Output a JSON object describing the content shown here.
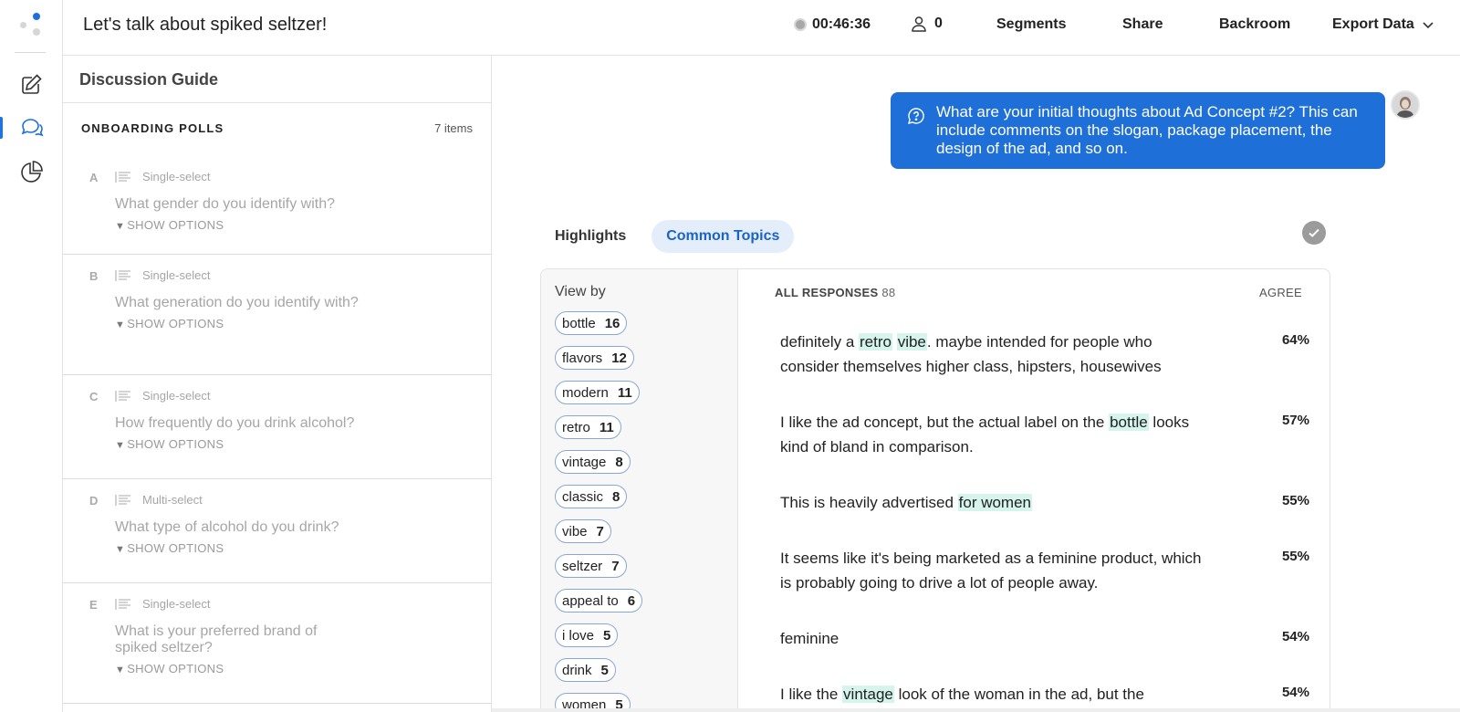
{
  "header": {
    "title": "Let's talk about spiked seltzer!",
    "timer": "00:46:36",
    "participants": "0",
    "segments": "Segments",
    "share": "Share",
    "backroom": "Backroom",
    "export": "Export Data"
  },
  "guide": {
    "title": "Discussion Guide",
    "section_name": "ONBOARDING POLLS",
    "section_count": "7 items",
    "show_options": "SHOW OPTIONS",
    "questions": [
      {
        "letter": "A",
        "type": "Single-select",
        "text": "What gender do you identify with?"
      },
      {
        "letter": "B",
        "type": "Single-select",
        "text": "What generation do you identify with?"
      },
      {
        "letter": "C",
        "type": "Single-select",
        "text": "How frequently do you drink alcohol?"
      },
      {
        "letter": "D",
        "type": "Multi-select",
        "text": "What type of alcohol do you drink?"
      },
      {
        "letter": "E",
        "type": "Single-select",
        "text": "What is your preferred brand of spiked seltzer?"
      }
    ]
  },
  "main": {
    "prompt": "What are your initial thoughts about Ad Concept #2? This can include comments on the slogan, package placement, the design of the ad, and so on.",
    "tabs": [
      {
        "label": "Highlights",
        "active": false
      },
      {
        "label": "Common Topics",
        "active": true
      }
    ],
    "view_by": "View by",
    "topics": [
      {
        "label": "bottle",
        "count": "16"
      },
      {
        "label": "flavors",
        "count": "12"
      },
      {
        "label": "modern",
        "count": "11"
      },
      {
        "label": "retro",
        "count": "11"
      },
      {
        "label": "vintage",
        "count": "8"
      },
      {
        "label": "classic",
        "count": "8"
      },
      {
        "label": "vibe",
        "count": "7"
      },
      {
        "label": "seltzer",
        "count": "7"
      },
      {
        "label": "appeal to",
        "count": "6"
      },
      {
        "label": "i love",
        "count": "5"
      },
      {
        "label": "drink",
        "count": "5"
      },
      {
        "label": "women",
        "count": "5"
      }
    ],
    "all_responses_label": "ALL RESPONSES",
    "all_responses_count": "88",
    "agree_label": "AGREE",
    "responses": [
      {
        "segments": [
          {
            "t": "definitely a "
          },
          {
            "t": "retro",
            "hl": true
          },
          {
            "t": " "
          },
          {
            "t": "vibe",
            "hl": true
          },
          {
            "t": ". maybe intended for people who consider themselves higher class, hipsters, housewives"
          }
        ],
        "agree": "64%"
      },
      {
        "segments": [
          {
            "t": "I like the ad concept, but the actual label on the "
          },
          {
            "t": "bottle",
            "hl": true
          },
          {
            "t": " looks kind of bland in comparison."
          }
        ],
        "agree": "57%"
      },
      {
        "segments": [
          {
            "t": "This is heavily advertised "
          },
          {
            "t": "for women",
            "hl": true
          }
        ],
        "agree": "55%"
      },
      {
        "segments": [
          {
            "t": "It seems like it's being marketed as a feminine product, which is probably going to drive a lot of people away."
          }
        ],
        "agree": "55%"
      },
      {
        "segments": [
          {
            "t": "feminine"
          }
        ],
        "agree": "54%"
      },
      {
        "segments": [
          {
            "t": "I like the "
          },
          {
            "t": "vintage",
            "hl": true
          },
          {
            "t": " look of the woman in the ad, but the"
          }
        ],
        "agree": "54%"
      }
    ]
  },
  "colors": {
    "accent": "#1f6fd9",
    "highlight": "#d4f4ec",
    "chip_border": "#8aa7d4"
  }
}
